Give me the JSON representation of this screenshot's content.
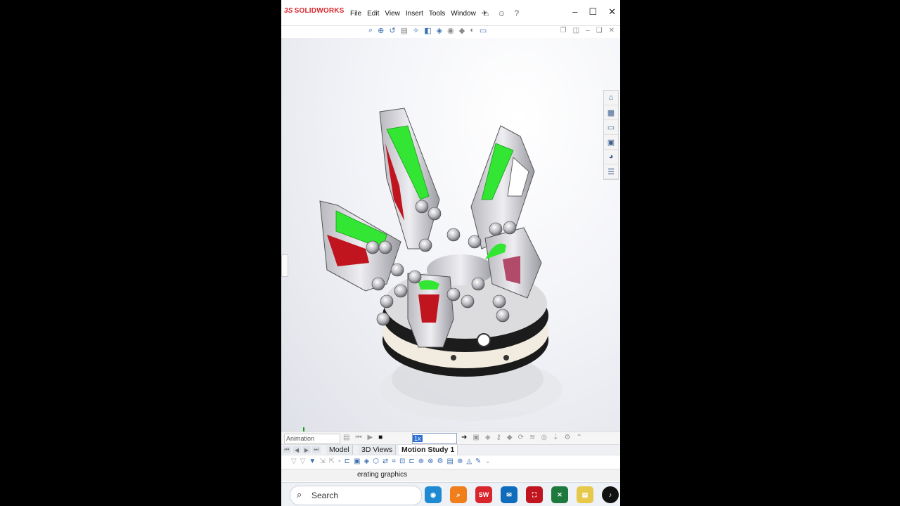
{
  "app": {
    "brand": "SOLIDWORKS",
    "brand_prefix": "3S"
  },
  "menu": [
    "File",
    "Edit",
    "View",
    "Insert",
    "Tools",
    "Window"
  ],
  "animation": {
    "mode": "Animation",
    "speed": "1x"
  },
  "tabs": [
    "Model",
    "3D Views",
    "Motion Study 1"
  ],
  "status": {
    "text": "erating graphics"
  },
  "taskbar": {
    "search_label": "Search",
    "sw_badge": "SW"
  },
  "colors": {
    "brand": "#d9262c",
    "green": "#33e633",
    "red": "#c0151f"
  }
}
